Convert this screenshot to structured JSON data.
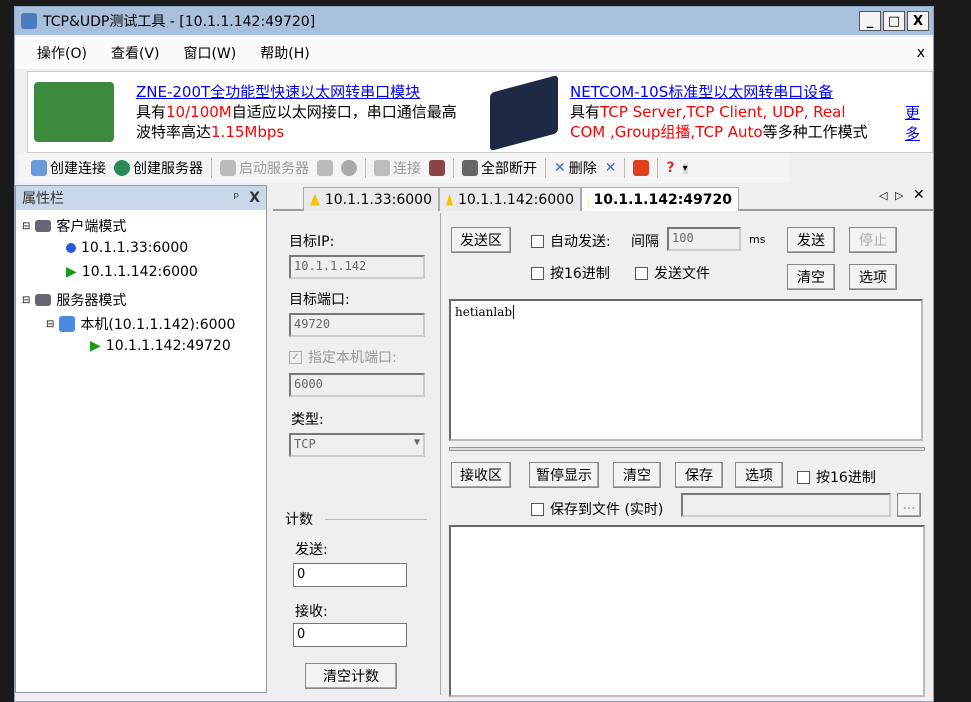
{
  "window": {
    "title": "TCP&UDP测试工具 - [10.1.1.142:49720]",
    "min": "_",
    "max": "□",
    "close": "X"
  },
  "menu": {
    "items": [
      "操作(O)",
      "查看(V)",
      "窗口(W)",
      "帮助(H)"
    ],
    "close": "x"
  },
  "banner": {
    "ad1": {
      "title": "ZNE-200T全功能型快速以太网转串口模块",
      "l1a": "具有",
      "l1b": "10/100M",
      "l1c": "自适应以太网接口，串口通信最高",
      "l2a": "波特率高达",
      "l2b": "1.15Mbps"
    },
    "ad2": {
      "title": "NETCOM-10S标准型以太网转串口设备",
      "l1a": "具有",
      "l1b": "TCP Server,TCP Client, UDP, Real",
      "l2a": "COM ,Group组播,TCP Auto",
      "l2b": "等多种工作模式"
    },
    "more": "更多"
  },
  "toolbar": {
    "create_conn": "创建连接",
    "create_server": "创建服务器",
    "start_server": "启动服务器",
    "connect": "连接",
    "disconnect_all": "全部断开",
    "delete": "删除"
  },
  "sidebar": {
    "title": "属性栏",
    "pin": "ᵖ",
    "close": "X",
    "client_mode": "客户端模式",
    "clients": [
      "10.1.1.33:6000",
      "10.1.1.142:6000"
    ],
    "server_mode": "服务器模式",
    "server": "本机(10.1.1.142):6000",
    "server_conn": "10.1.1.142:49720"
  },
  "tabs": [
    {
      "label": "10.1.1.33:6000"
    },
    {
      "label": "10.1.1.142:6000"
    },
    {
      "label": "10.1.1.142:49720",
      "active": true
    }
  ],
  "left": {
    "target_ip_label": "目标IP:",
    "target_ip": "10.1.1.142",
    "target_port_label": "目标端口:",
    "target_port": "49720",
    "local_port_label": "指定本机端口:",
    "local_port_checked": true,
    "local_port": "6000",
    "type_label": "类型:",
    "type": "TCP",
    "count_label": "计数",
    "send_label": "发送:",
    "send_count": "0",
    "recv_label": "接收:",
    "recv_count": "0",
    "clear_count": "清空计数"
  },
  "send": {
    "area": "发送区",
    "auto_send": "自动发送:",
    "interval_label": "间隔",
    "interval": "100",
    "unit": "ms",
    "send": "发送",
    "stop": "停止",
    "hex": "按16进制",
    "send_file": "发送文件",
    "clear": "清空",
    "options": "选项",
    "content": "hetianlab"
  },
  "recv": {
    "area": "接收区",
    "pause": "暂停显示",
    "clear": "清空",
    "save": "保存",
    "options": "选项",
    "hex": "按16进制",
    "save_file": "保存到文件 (实时)",
    "browse": "..."
  }
}
